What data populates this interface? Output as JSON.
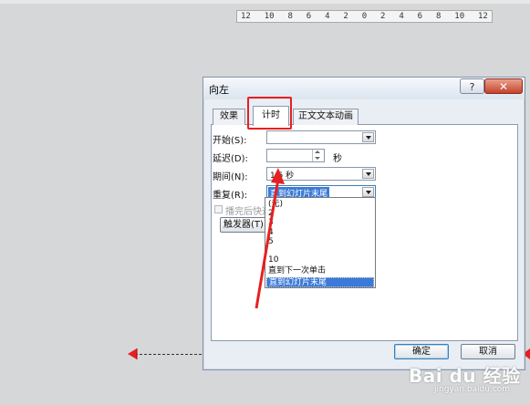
{
  "ruler": {
    "ticks": [
      "12",
      "10",
      "8",
      "6",
      "4",
      "2",
      "0",
      "2",
      "4",
      "6",
      "8",
      "10",
      "12"
    ]
  },
  "dialog": {
    "title": "向左",
    "help_label": "?",
    "close_label": "✕",
    "tabs": [
      {
        "label": "效果"
      },
      {
        "label": "计时"
      },
      {
        "label": "正文文本动画"
      }
    ],
    "start": {
      "label": "开始(S):",
      "value": ""
    },
    "delay": {
      "label": "延迟(D):",
      "value": "",
      "unit": "秒"
    },
    "duration": {
      "label": "期间(N):",
      "value": "1.5 秒"
    },
    "repeat": {
      "label": "重复(R):",
      "value": "直到幻灯片末尾"
    },
    "rewind": {
      "label": "播完后快退(W)"
    },
    "trigger_button": "触发器(T)",
    "repeat_options": [
      "(无)",
      "2",
      "3",
      "4",
      "5",
      "10",
      "直到下一次单击",
      "直到幻灯片末尾"
    ],
    "selected_option_index": 7,
    "ok_label": "确定",
    "cancel_label": "取消"
  },
  "watermark": {
    "brand": "Bai du 经验",
    "url": "jingyan.baidu.com"
  },
  "colors": {
    "annotation": "#e62020",
    "selection": "#3b7ad8",
    "dialog_bg": "#e9eef5"
  }
}
